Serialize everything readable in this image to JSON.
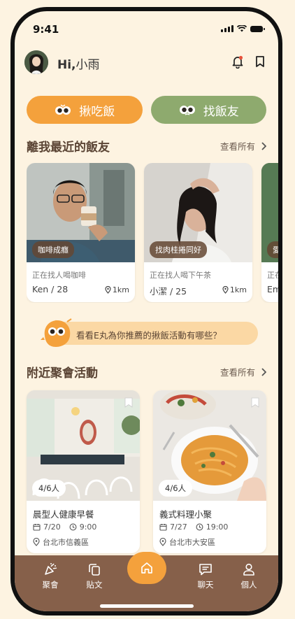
{
  "status_bar": {
    "time": "9:41"
  },
  "header": {
    "greeting_prefix": "Hi,",
    "user_name": "小雨"
  },
  "actions": {
    "eat_label": "揪吃飯",
    "find_label": "找飯友"
  },
  "nearby_friends": {
    "title": "離我最近的飯友",
    "see_all": "查看所有",
    "cards": [
      {
        "tag": "咖啡成癮",
        "status": "正在找人喝咖啡",
        "name_age": "Ken / 28",
        "distance": "1km"
      },
      {
        "tag": "找肉桂捲同好",
        "status": "正在找人喝下午茶",
        "name_age": "小潔 / 25",
        "distance": "1km"
      },
      {
        "tag": "愛",
        "status": "正在",
        "name_age": "Em",
        "distance": ""
      }
    ]
  },
  "banner": {
    "text": "看看E丸為你推薦的揪飯活動有哪些？"
  },
  "nearby_events": {
    "title": "附近聚會活動",
    "see_all": "查看所有",
    "cards": [
      {
        "count": "4/6人",
        "title": "晨型人健康早餐",
        "date": "7/20",
        "time": "9:00",
        "location": "台北市信義區"
      },
      {
        "count": "4/6人",
        "title": "義式料理小聚",
        "date": "7/27",
        "time": "19:00",
        "location": "台北市大安區"
      }
    ]
  },
  "tabbar": {
    "party": "聚會",
    "post": "貼文",
    "chat": "聊天",
    "profile": "個人"
  },
  "colors": {
    "background": "#fdf3e1",
    "orange": "#f4a13c",
    "green": "#8eaa6e",
    "brown": "#86604a",
    "banner": "#fbd8a4"
  }
}
